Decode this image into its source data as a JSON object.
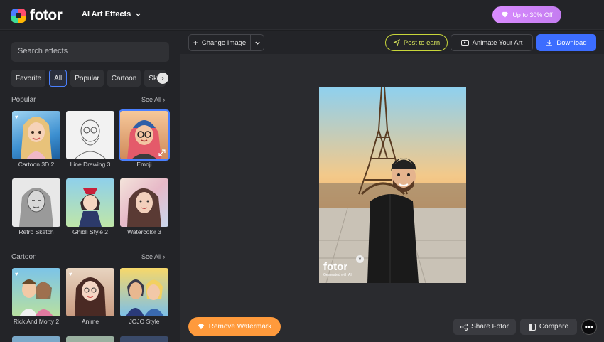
{
  "app": {
    "logo_text": "fotor",
    "title": "AI Art Effects",
    "promo": "Up to 30% Off"
  },
  "sidebar": {
    "search_placeholder": "Search effects",
    "chips": [
      "Favorite",
      "All",
      "Popular",
      "Cartoon",
      "Sket"
    ],
    "popular": {
      "title": "Popular",
      "see_all": "See All",
      "items": [
        {
          "label": "Cartoon 3D 2"
        },
        {
          "label": "Line Drawing 3"
        },
        {
          "label": "Emoji"
        },
        {
          "label": "Retro Sketch"
        },
        {
          "label": "Ghibli Style 2"
        },
        {
          "label": "Watercolor 3"
        }
      ]
    },
    "cartoon": {
      "title": "Cartoon",
      "see_all": "See All",
      "items": [
        {
          "label": "Rick And Morty 2"
        },
        {
          "label": "Anime"
        },
        {
          "label": "JOJO Style"
        }
      ]
    }
  },
  "toolbar": {
    "change_image": "Change Image",
    "post_to_earn": "Post to earn",
    "animate": "Animate Your Art",
    "download": "Download"
  },
  "canvas": {
    "watermark": "fotor",
    "watermark_sub": "Generated with AI"
  },
  "footer": {
    "remove_watermark": "Remove Watermark",
    "share": "Share Fotor",
    "compare": "Compare"
  }
}
